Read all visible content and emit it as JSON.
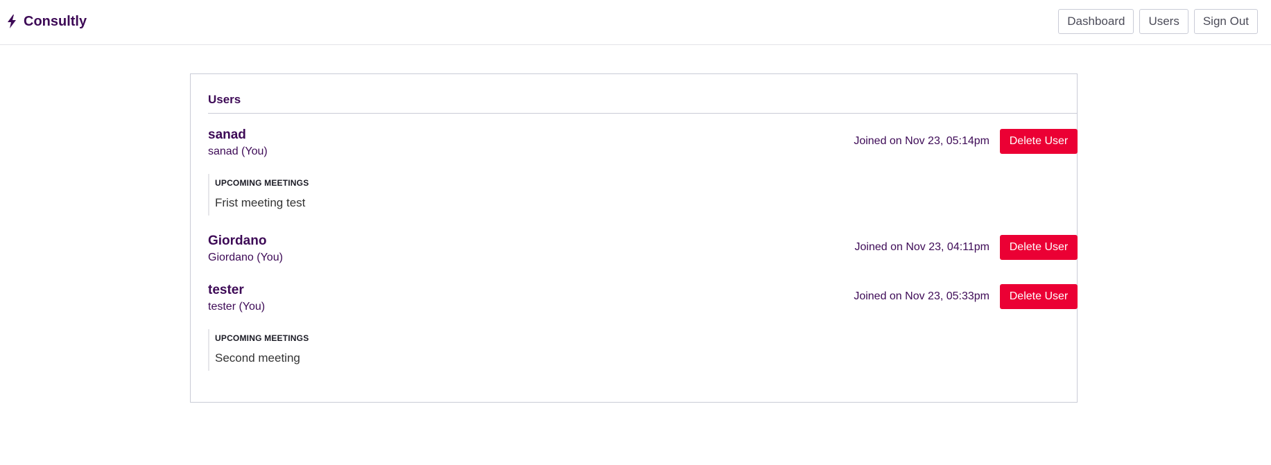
{
  "header": {
    "brand": "Consultly",
    "nav": [
      {
        "label": "Dashboard"
      },
      {
        "label": "Users"
      },
      {
        "label": "Sign Out"
      }
    ]
  },
  "users_card": {
    "title": "Users",
    "delete_label": "Delete User",
    "meetings_heading": "UPCOMING MEETINGS",
    "users": [
      {
        "name": "sanad",
        "sub": "sanad (You)",
        "joined": "Joined on Nov 23, 05:14pm",
        "meetings": [
          "Frist meeting test"
        ]
      },
      {
        "name": "Giordano",
        "sub": "Giordano (You)",
        "joined": "Joined on Nov 23, 04:11pm",
        "meetings": []
      },
      {
        "name": "tester",
        "sub": "tester (You)",
        "joined": "Joined on Nov 23, 05:33pm",
        "meetings": [
          "Second meeting"
        ]
      }
    ]
  },
  "colors": {
    "brand": "#3d0a56",
    "danger": "#eb0034",
    "border": "#c9cbd6"
  }
}
